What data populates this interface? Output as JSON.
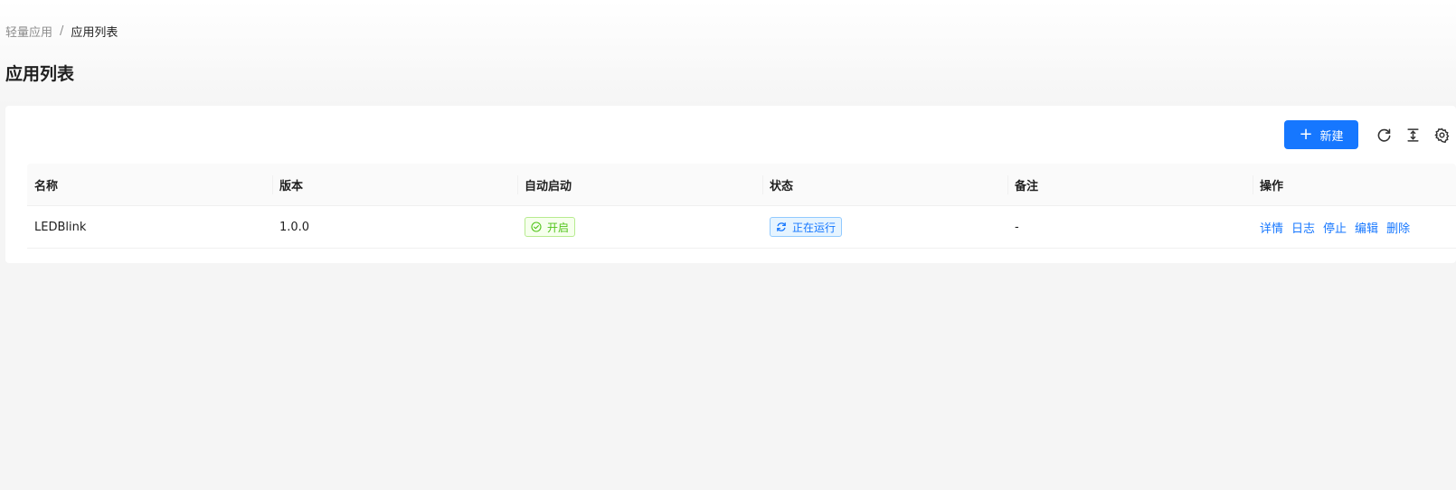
{
  "breadcrumb": {
    "parent": "轻量应用",
    "separator": "/",
    "current": "应用列表"
  },
  "page": {
    "title": "应用列表"
  },
  "toolbar": {
    "new_label": "新建",
    "icons": [
      "reload-icon",
      "column-height-icon",
      "setting-icon"
    ]
  },
  "table": {
    "columns": [
      "名称",
      "版本",
      "自动启动",
      "状态",
      "备注",
      "操作"
    ],
    "rows": [
      {
        "name": "LEDBlink",
        "version": "1.0.0",
        "autostart": "开启",
        "status": "正在运行",
        "remark": "-",
        "actions": [
          "详情",
          "日志",
          "停止",
          "编辑",
          "删除"
        ]
      }
    ]
  },
  "colors": {
    "primary": "#1677ff",
    "success": "#52c41a"
  }
}
